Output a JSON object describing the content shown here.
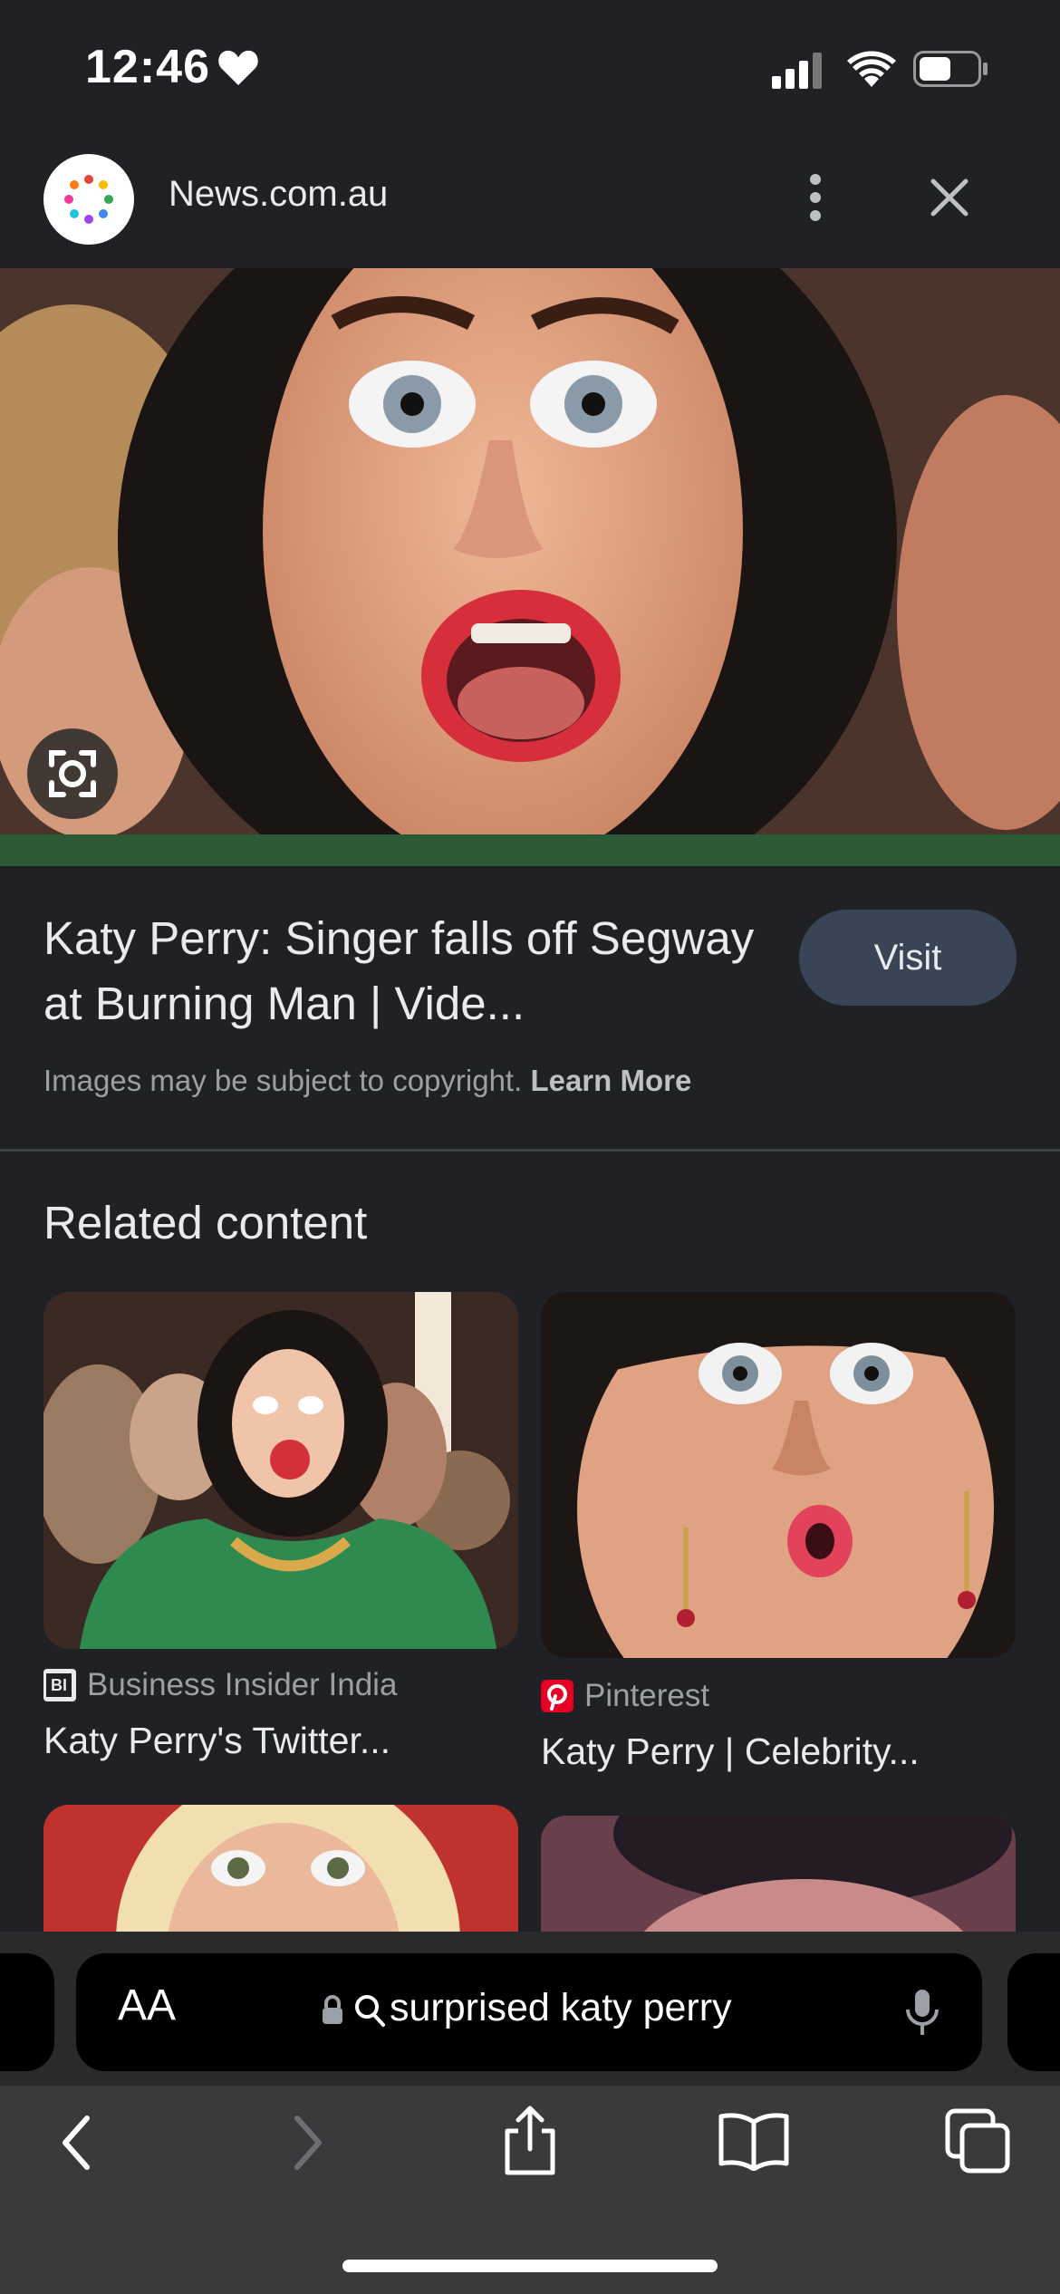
{
  "status_bar": {
    "time": "12:46"
  },
  "header": {
    "site_name": "News.com.au"
  },
  "result": {
    "title": "Katy Perry: Singer falls off Segway at Burning Man | Vide...",
    "visit_label": "Visit",
    "copyright_text": "Images may be subject to copyright.",
    "learn_more_label": "Learn More"
  },
  "related": {
    "heading": "Related content",
    "items": [
      {
        "source": "Business Insider India",
        "source_icon": "BI",
        "caption": "Katy Perry's Twitter..."
      },
      {
        "source": "Pinterest",
        "source_icon": "pinterest-icon",
        "caption": "Katy Perry | Celebrity..."
      }
    ]
  },
  "browser": {
    "text_size_label": "AA",
    "url_text": "surprised katy perry"
  },
  "colors": {
    "background": "#202124",
    "visit_button": "#394457",
    "url_bar": "#000000",
    "toolbar": "#3a3a3c"
  }
}
